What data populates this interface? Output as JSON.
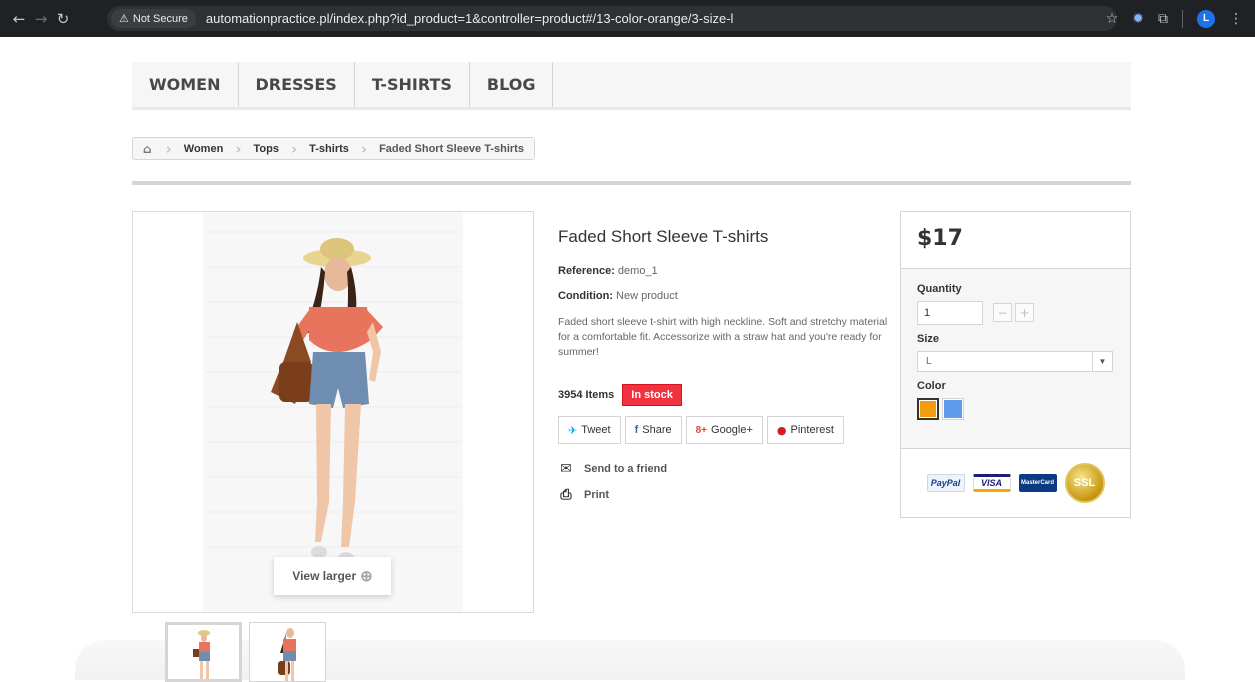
{
  "browser": {
    "security_label": "Not Secure",
    "url": "automationpractice.pl/index.php?id_product=1&controller=product#/13-color-orange/3-size-l",
    "profile_initial": "L"
  },
  "menu": {
    "items": [
      "WOMEN",
      "DRESSES",
      "T-SHIRTS",
      "BLOG"
    ]
  },
  "breadcrumb": {
    "items": [
      "Women",
      "Tops",
      "T-shirts"
    ],
    "current": "Faded Short Sleeve T-shirts"
  },
  "image": {
    "view_larger": "View larger"
  },
  "product": {
    "title": "Faded Short Sleeve T-shirts",
    "reference_label": "Reference:",
    "reference": "demo_1",
    "condition_label": "Condition:",
    "condition": "New product",
    "description": "Faded short sleeve t-shirt with high neckline. Soft and stretchy material for a comfortable fit. Accessorize with a straw hat and you're ready for summer!",
    "quantity_text": "3954 Items",
    "stock": "In stock",
    "social": [
      {
        "icon": "twitter-icon",
        "glyph": "🐦",
        "label": "Tweet",
        "color": "#00aaf0"
      },
      {
        "icon": "facebook-icon",
        "glyph": "f",
        "label": "Share",
        "color": "#435f9f"
      },
      {
        "icon": "google-plus-icon",
        "glyph": "8+",
        "label": "Google+",
        "color": "#e04b34"
      },
      {
        "icon": "pinterest-icon",
        "glyph": "℗",
        "label": "Pinterest",
        "color": "#ce1f21"
      }
    ],
    "send_to_friend": "Send to a friend",
    "print": "Print"
  },
  "buybox": {
    "price": "$17",
    "quantity_label": "Quantity",
    "quantity_value": "1",
    "size_label": "Size",
    "size_value": "L",
    "color_label": "Color",
    "colors": [
      {
        "name": "Orange",
        "hex": "#f39c11",
        "selected": true
      },
      {
        "name": "Blue",
        "hex": "#5d9cec",
        "selected": false
      }
    ],
    "payments": [
      "PayPal",
      "VISA",
      "MasterCard",
      "SSL"
    ]
  }
}
